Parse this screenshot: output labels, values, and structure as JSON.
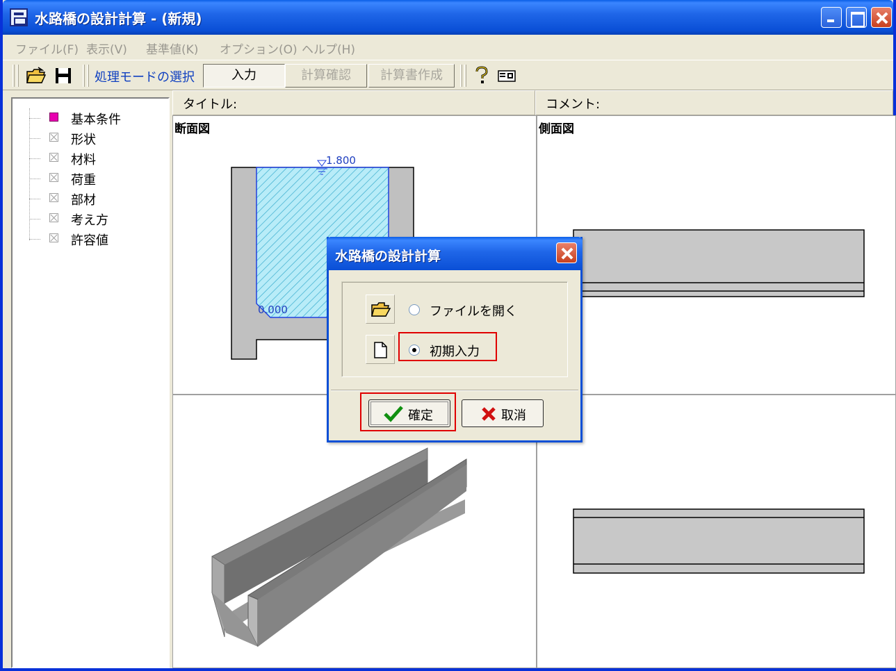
{
  "window": {
    "title": "水路橋の設計計算 - (新規)"
  },
  "menu": [
    "ファイル(F)",
    "表示(V)",
    "基準値(K)",
    "オプション(O)",
    "ヘルプ(H)"
  ],
  "toolbar": {
    "mode_label": "処理モードの選択",
    "buttons": [
      "入力",
      "計算確認",
      "計算書作成"
    ]
  },
  "tree": {
    "items": [
      "基本条件",
      "形状",
      "材料",
      "荷重",
      "部材",
      "考え方",
      "許容値"
    ]
  },
  "headers": {
    "title_label": "タイトル:",
    "comment_label": "コメント:"
  },
  "panes": {
    "section_title": "断面図",
    "side_title": "側面図",
    "water_level": "1.800",
    "bottom_level": "0.000"
  },
  "dialog": {
    "title": "水路橋の設計計算",
    "options": [
      {
        "label": "ファイルを開く",
        "selected": false,
        "icon": "folder-open-icon"
      },
      {
        "label": "初期入力",
        "selected": true,
        "icon": "new-document-icon"
      }
    ],
    "ok_label": "確定",
    "cancel_label": "取消"
  },
  "colors": {
    "selection_highlight": "#e00000",
    "water_fill": "#00b8e0",
    "structure_gray": "#c8c8c8"
  }
}
